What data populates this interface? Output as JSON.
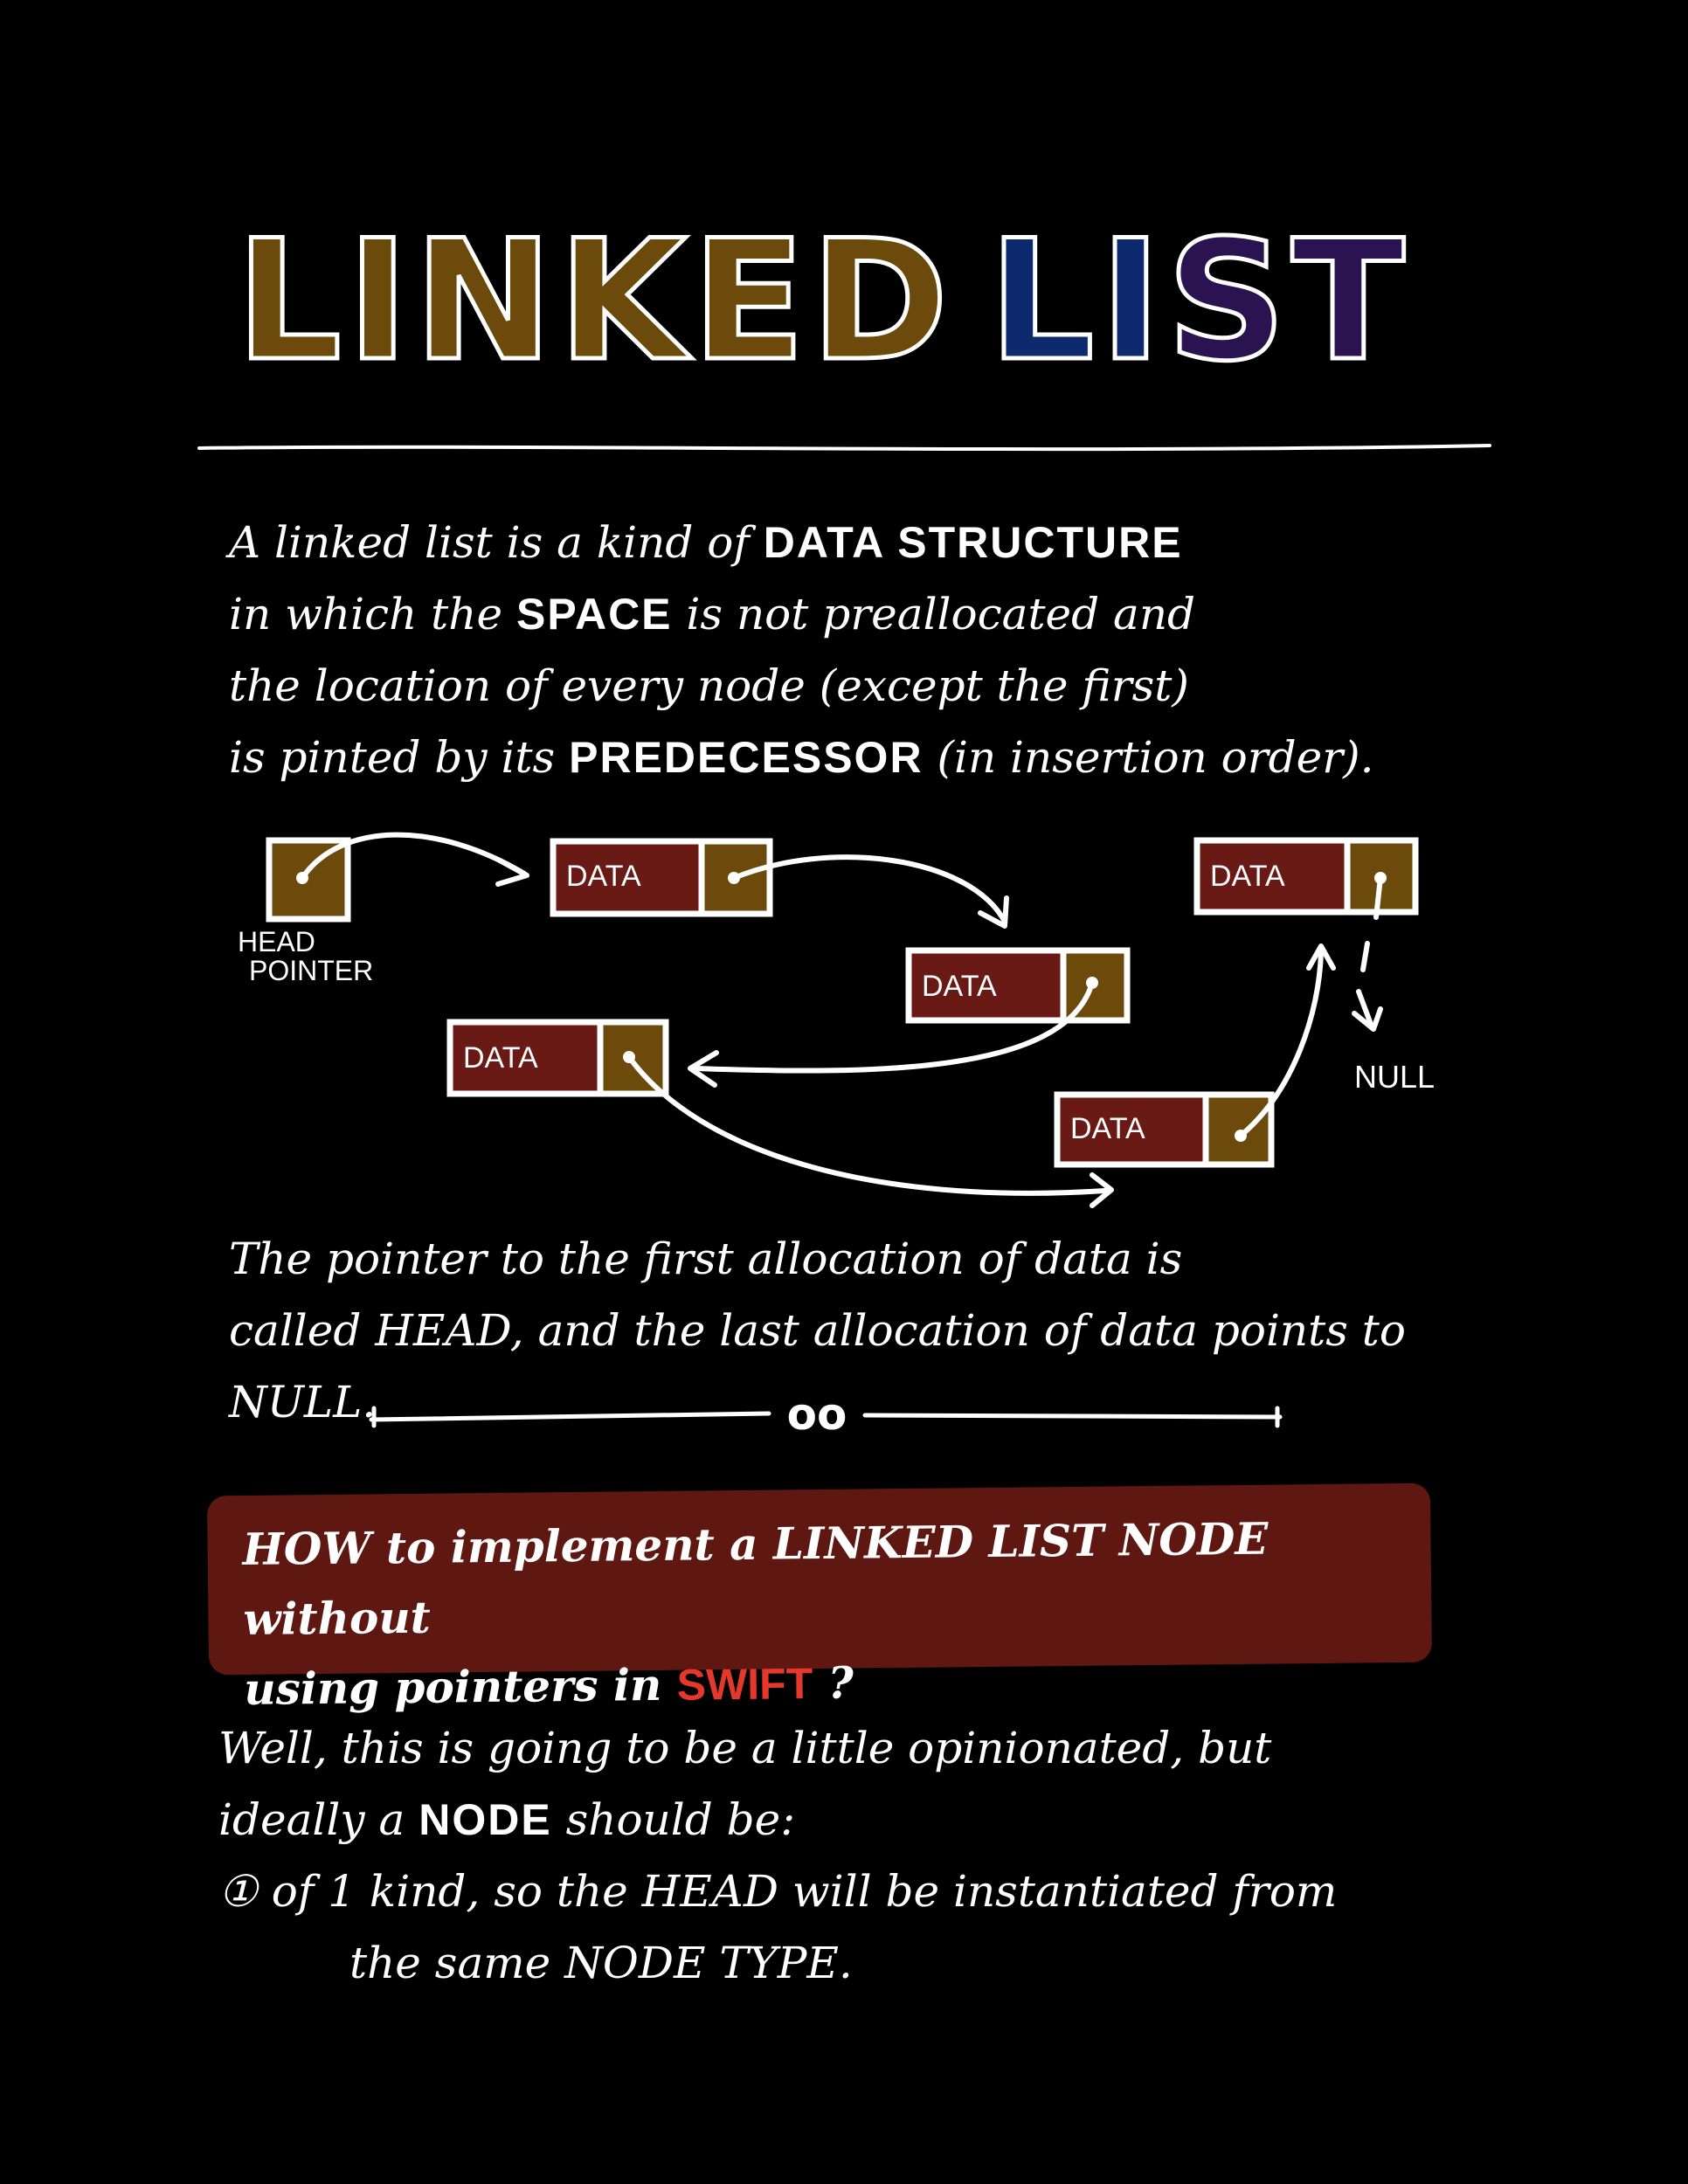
{
  "title": {
    "word1": "LINKED",
    "word2_part1": "LI",
    "word2_part2": "ST"
  },
  "intro": {
    "line1_pre": "A linked list is a kind of ",
    "line1_bold": "DATA STRUCTURE",
    "line2_pre": "in which the ",
    "line2_bold": "SPACE",
    "line2_post": " is not preallocated and",
    "line3": "the location of every node (except the first)",
    "line4_pre": "is pinted by its ",
    "line4_bold": "PREDECESSOR",
    "line4_post": " (in insertion order)."
  },
  "diagram": {
    "node_label": "DATA",
    "head_label_line1": "HEAD",
    "head_label_line2": "POINTER",
    "null_label": "NULL",
    "colors": {
      "data_fill": "#6a1a14",
      "pointer_fill": "#6b4a0c",
      "stroke": "#ffffff"
    }
  },
  "head_note": {
    "line1": "The pointer to the first allocation of data is",
    "line2": "called HEAD, and the last allocation of data points to NULL."
  },
  "divider": {
    "center": "oo"
  },
  "question": {
    "line1": "HOW to implement a LINKED LIST NODE without",
    "line2_pre": "using pointers in ",
    "line2_swift": "SWIFT",
    "line2_post": " ?"
  },
  "well": {
    "line1": "Well, this is going to be a little opinionated, but",
    "line2_pre": "ideally a ",
    "line2_bold": "NODE",
    "line2_post": " should be:",
    "line3": "① of 1 kind, so the HEAD will be instantiated from",
    "line4": "the same NODE TYPE."
  }
}
